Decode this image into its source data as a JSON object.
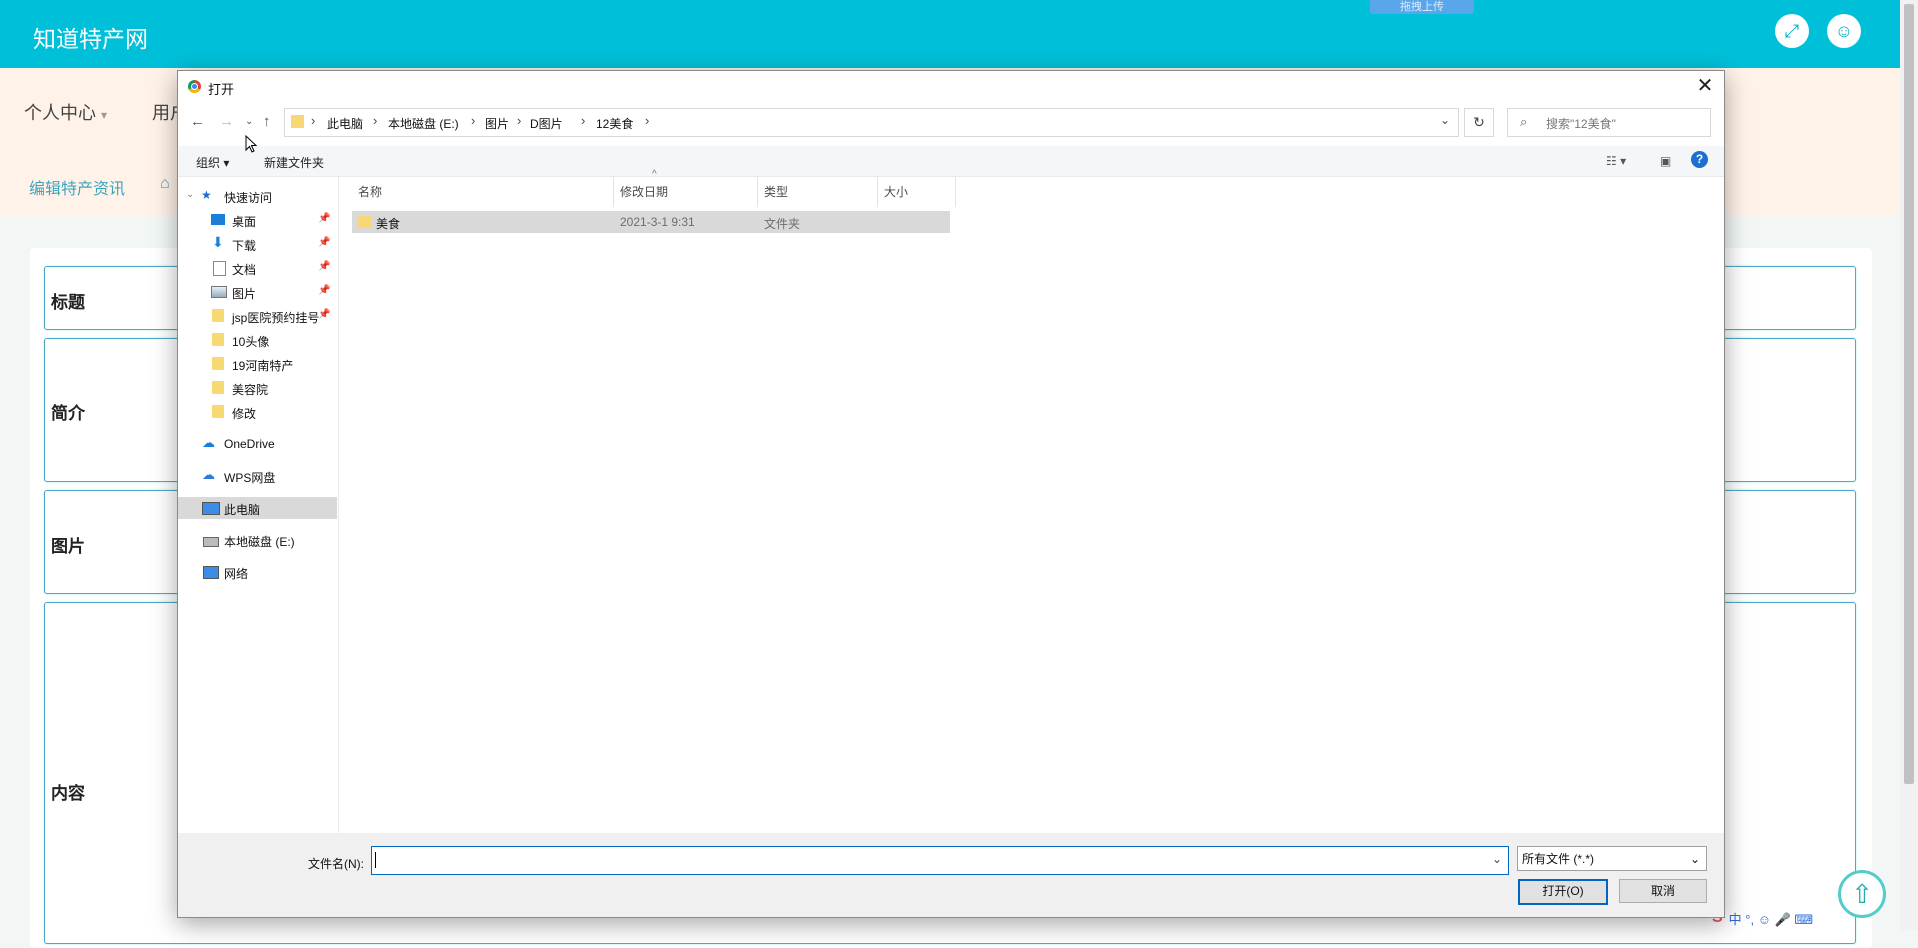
{
  "app": {
    "brand": "知道特产网",
    "drag_upload": "拖拽上传",
    "nav1": [
      "个人中心",
      "用户"
    ],
    "nav2": [
      "编辑特产资讯",
      "⌂"
    ],
    "form_labels": [
      "标题",
      "简介",
      "图片",
      "内容"
    ]
  },
  "dialog": {
    "title": "打开",
    "breadcrumbs": [
      "此电脑",
      "本地磁盘 (E:)",
      "图片",
      "D图片",
      "12美食"
    ],
    "search_placeholder": "搜索\"12美食\"",
    "toolbar": {
      "organize": "组织 ▾",
      "new_folder": "新建文件夹"
    },
    "nav": {
      "quick_access": "快速访问",
      "quick_items": [
        "桌面",
        "下载",
        "文档",
        "图片",
        "jsp医院预约挂号",
        "10头像",
        "19河南特产",
        "美容院",
        "修改"
      ],
      "onedrive": "OneDrive",
      "wps": "WPS网盘",
      "this_pc": "此电脑",
      "local_disk": "本地磁盘 (E:)",
      "network": "网络"
    },
    "columns": {
      "name": "名称",
      "modified": "修改日期",
      "type": "类型",
      "size": "大小"
    },
    "files": [
      {
        "name": "美食",
        "modified": "2021-3-1 9:31",
        "type": "文件夹",
        "size": ""
      }
    ],
    "filename_label": "文件名(N):",
    "filename_value": "",
    "filetype": "所有文件 (*.*)",
    "open_button": "打开(O)",
    "cancel_button": "取消"
  },
  "ime": "中 °, ☺ 🎤 ⌨"
}
